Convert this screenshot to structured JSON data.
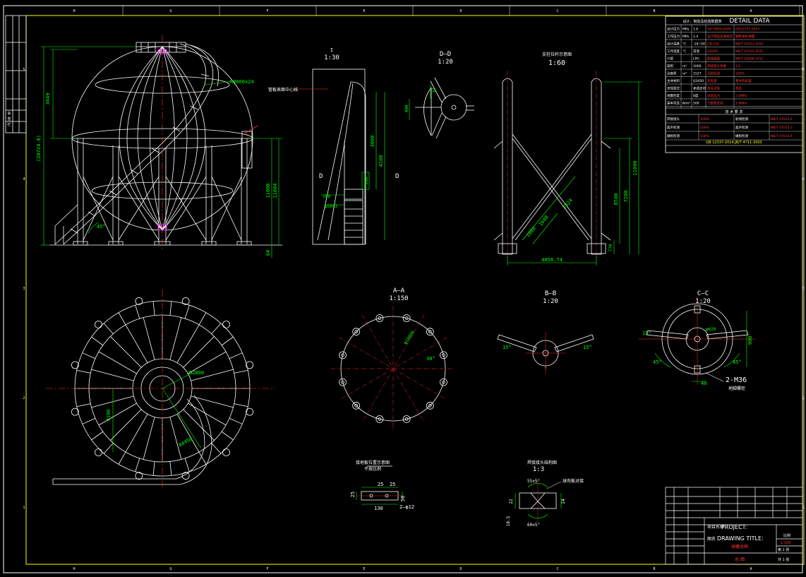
{
  "colors": {
    "background": "#000000",
    "frame": "#ffffff",
    "geometry": "#ffffff",
    "dimension": "#00ff00",
    "centerline": "#ff3030",
    "cyan": "#00ffff",
    "yellow": "#ffff00",
    "magenta": "#ff00ff"
  },
  "border": {
    "top_zones": [
      "H",
      "G",
      "F",
      "E",
      "D",
      "C",
      "B",
      "A"
    ],
    "bottom_zones": [
      "H",
      "G",
      "F",
      "E",
      "D",
      "C",
      "B",
      "A"
    ],
    "left_rows": [
      "5",
      "4",
      "3",
      "2",
      "1"
    ],
    "right_rows": [
      "5",
      "4",
      "3",
      "2",
      "1"
    ]
  },
  "elevation": {
    "dim_3049": "3049",
    "dim_20724": "(20724.8)",
    "dim_radius": "R9000x24",
    "dim_11000": "11000",
    "dim_11084": "11084",
    "dim_64": "64",
    "angle_45": "45°"
  },
  "view_i": {
    "label": "I",
    "scale": "1:30",
    "leader_note": "管板表面中心线",
    "dim_3000": "3000",
    "dim_4100": "4100",
    "dim_200": "200",
    "dim_188": "188",
    "dim_phi": "φ50X3",
    "section_left": "D",
    "section_right": "D"
  },
  "view_dd": {
    "label": "D—D",
    "scale": "1:20",
    "dim_14": "14",
    "dim_400": "400"
  },
  "view_bracing": {
    "title": "支柱拉杆示意图",
    "scale": "1:60",
    "dim_11000": "11000",
    "dim_7200": "7200",
    "dim_8500": "8500",
    "dim_7824": "7824",
    "dim_1600": "1600",
    "dim_1000": "1000",
    "dim_770": "770",
    "dim_4858": "4858.74"
  },
  "plan": {
    "dim_r2800": "R2800",
    "dim_9196": "9196",
    "dim_r4458": "R4458"
  },
  "view_aa": {
    "label": "A—A",
    "scale": "1:150",
    "dim_phi": "φ18000",
    "angle_30": "30°"
  },
  "view_bb": {
    "label": "B—B",
    "scale": "1:20",
    "angle_left": "15°",
    "angle_right": "15°"
  },
  "view_cc": {
    "label": "C—C",
    "scale": "1:20",
    "angle_15": "15°",
    "angle_45a": "45°",
    "angle_45b": "45°",
    "dim_900": "900",
    "dim_620": "φ620",
    "dim_40": "40",
    "bolt_note": "2-M36",
    "bolt_sub": "地脚螺栓"
  },
  "detail_small": {
    "title": "接地板位置示意图",
    "scale": "不按比例",
    "dim_25a": "25",
    "dim_25b": "25",
    "dim_50": "50",
    "dim_25c": "25",
    "dim_130": "130",
    "note": "2—φ12"
  },
  "detail_weld": {
    "title": "焊接接头结构图",
    "scale": "1:3",
    "angle_top": "55±5°",
    "angle_bottom": "60±5°",
    "dim_22": "22",
    "dim_24": "24",
    "dim_105": "10.5",
    "note": "球壳板对接"
  },
  "detail_data": {
    "header": "DETAIL DATA",
    "header_cn": "设计、制造及检验数据表",
    "rows": [
      [
        "设计压力",
        "MPa",
        "1.6",
        "ISO 9000-2000",
        "GB12337-2014"
      ],
      [
        "工作压力",
        "MPa",
        "1.4",
        "设计制造验收规范",
        "钢制球形储罐"
      ],
      [
        "设计温度",
        "°C",
        "-19~50",
        "GB-150",
        "NB/T 47013-2015"
      ],
      [
        "工作温度",
        "°C",
        "常温",
        "Q345R",
        "NB/T 47014-2011"
      ],
      [
        "介质",
        "",
        "LPG",
        "腐蚀裕量",
        "NB/T 20008-2012"
      ],
      [
        "容积",
        "m³",
        "1000",
        "焊接接头系数",
        "1.0"
      ],
      [
        "全容积",
        "m³",
        "1527",
        "无损检测",
        "100%"
      ],
      [
        "主体材料",
        "",
        "Q345R",
        "热处理",
        "整体热处理"
      ],
      [
        "支柱型式",
        "",
        "赤道正切",
        "耐压试验",
        "液压"
      ],
      [
        "地震烈度",
        "",
        "8度",
        "试验压力",
        "2.0MPa"
      ],
      [
        "基本风压",
        "N/m²",
        "500",
        "气密性试验",
        "1.6MPa"
      ]
    ],
    "mid_header": "技 术 要 求",
    "req_rows": [
      [
        "焊接接头",
        "100%",
        "射线检测",
        "NB/T 47013.2"
      ],
      [
        "超声检测",
        "100%",
        "超声检测",
        "NB/T 47013.3"
      ],
      [
        "磁粉检测",
        "100%",
        "磁粉检测",
        "NB/T 47013.4"
      ]
    ],
    "footer": "GB 12337-2014,JB/T 4711-2003"
  },
  "title_block": {
    "project_cn": "项目名称",
    "project_en": "PROJECT:",
    "drawing_cn": "图名",
    "drawing_en": "DRAWING TITLE:",
    "drawing_value": "球罐总图",
    "scale_label": "比例",
    "scale_value": "1:100",
    "sheet_label": "第 1 张",
    "sheet_total": "共 1 张",
    "drawing_no_value": "总 图"
  },
  "left_strip": {
    "labels": [
      "会",
      "签",
      "栏"
    ]
  }
}
